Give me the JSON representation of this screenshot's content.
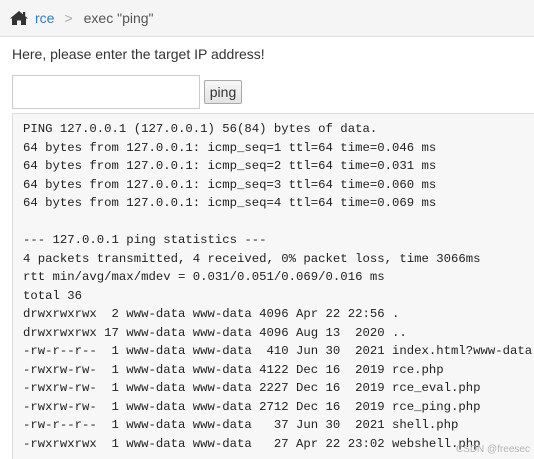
{
  "breadcrumb": {
    "home_icon": "home-icon",
    "link": "rce",
    "separator": ">",
    "current": "exec \"ping\""
  },
  "form": {
    "prompt": "Here, please enter the target IP address!",
    "ip_value": "",
    "button_label": "ping"
  },
  "output_lines": [
    "PING 127.0.0.1 (127.0.0.1) 56(84) bytes of data.",
    "64 bytes from 127.0.0.1: icmp_seq=1 ttl=64 time=0.046 ms",
    "64 bytes from 127.0.0.1: icmp_seq=2 ttl=64 time=0.031 ms",
    "64 bytes from 127.0.0.1: icmp_seq=3 ttl=64 time=0.060 ms",
    "64 bytes from 127.0.0.1: icmp_seq=4 ttl=64 time=0.069 ms",
    "",
    "--- 127.0.0.1 ping statistics ---",
    "4 packets transmitted, 4 received, 0% packet loss, time 3066ms",
    "rtt min/avg/max/mdev = 0.031/0.051/0.069/0.016 ms",
    "total 36",
    "drwxrwxrwx  2 www-data www-data 4096 Apr 22 22:56 .",
    "drwxrwxrwx 17 www-data www-data 4096 Aug 13  2020 ..",
    "-rw-r--r--  1 www-data www-data  410 Jun 30  2021 index.html?www-data",
    "-rwxrw-rw-  1 www-data www-data 4122 Dec 16  2019 rce.php",
    "-rwxrw-rw-  1 www-data www-data 2227 Dec 16  2019 rce_eval.php",
    "-rwxrw-rw-  1 www-data www-data 2712 Dec 16  2019 rce_ping.php",
    "-rw-r--r--  1 www-data www-data   37 Jun 30  2021 shell.php",
    "-rwxrwxrwx  1 www-data www-data   27 Apr 22 23:02 webshell.php"
  ],
  "watermark": "CSDN @freesec",
  "colors": {
    "link": "#2e7dc5",
    "breadcrumb_bg": "#f5f5f5",
    "output_bg": "#f7f7f7"
  }
}
